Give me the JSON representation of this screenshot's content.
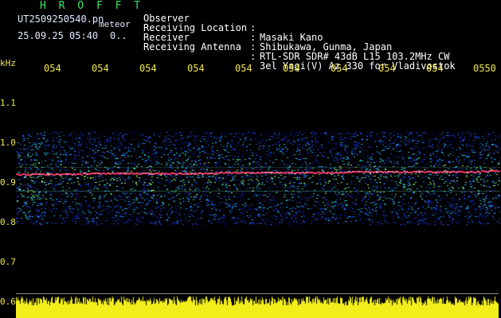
{
  "header": {
    "station": "H R O F F T",
    "filename": "UT2509250540.pn",
    "meteor_label": "meteor",
    "datetime": "25.09.25 05:40",
    "zero_label": "0..",
    "info": [
      {
        "label": "Observer",
        "value": "Masaki Kano"
      },
      {
        "label": "Receiving Location",
        "value": "Shibukawa, Gunma, Japan"
      },
      {
        "label": "Receiver",
        "value": "RTL-SDR SDR# 43dB L15 103.2MHz CW"
      },
      {
        "label": "Receiving Antenna",
        "value": "3el Yagi(V) Az 330 for Vladivostok"
      }
    ],
    "separator": ":"
  },
  "spectrogram": {
    "y_unit": "kHz",
    "time_ticks": [
      "054",
      "054",
      "054",
      "054",
      "054",
      "054",
      "054",
      "054",
      "054",
      "0550"
    ],
    "freq_ticks": [
      "1.1",
      "1.0",
      "0.9",
      "0.8",
      "0.7",
      "0.6"
    ],
    "signal_color": "#ff3d6b",
    "noise_colors": [
      "#0b1a8a",
      "#1f4fd6",
      "#1fb6d8",
      "#35d6a8",
      "#9ef06a"
    ],
    "amplitude_color": "#f2ee1c"
  }
}
